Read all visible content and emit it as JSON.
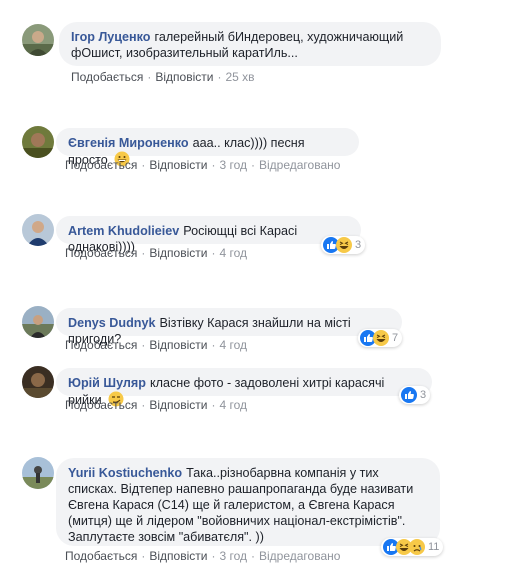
{
  "actions": {
    "like": "Подобається",
    "reply": "Відповісти",
    "edited": "Відредаговано"
  },
  "comments": [
    {
      "author": "Ігор Луценко",
      "text": "галерейный бИндеровец, художничающий фОшист, изобразительный каратИль...",
      "time": "25 хв"
    },
    {
      "author": "Євгенія Мироненко",
      "text": "ааа.. клас)))) песня просто",
      "time": "3 год",
      "emoji": "grinning-emoji-icon"
    },
    {
      "author": "Artem Khudolieiev",
      "text": "Росіющці всі Карасі однакові))))",
      "time": "4 год",
      "reactions": [
        "like-reaction-icon",
        "haha-reaction-icon"
      ],
      "reaction_count": "3"
    },
    {
      "author": "Denys Dudnyk",
      "text": "Візтівку Карася знайшли на місті пригоди?",
      "time": "4 год",
      "reactions": [
        "like-reaction-icon",
        "haha-reaction-icon"
      ],
      "reaction_count": "7"
    },
    {
      "author": "Юрій Шуляр",
      "text": "класне фото - задоволені хитрі карасячі рийки",
      "time": "4 год",
      "emoji": "smirk-emoji-icon",
      "reactions": [
        "like-reaction-icon"
      ],
      "reaction_count": "3"
    },
    {
      "author": "Yurii Kostiuchenko",
      "text": "Така..різнобарвна компанія у тих списках. Відтепер напевно рашапропаганда буде називати Євгена Карася (С14) ще й галеристом, а Євгена Карася (митця) ще й лідером \"войовничих націонал-екстрімістів\". Заплутаєте зовсім \"абиватєля\". ))",
      "time": "3 год",
      "reactions": [
        "like-reaction-icon",
        "haha-reaction-icon",
        "sad-reaction-icon"
      ],
      "reaction_count": "11"
    }
  ]
}
